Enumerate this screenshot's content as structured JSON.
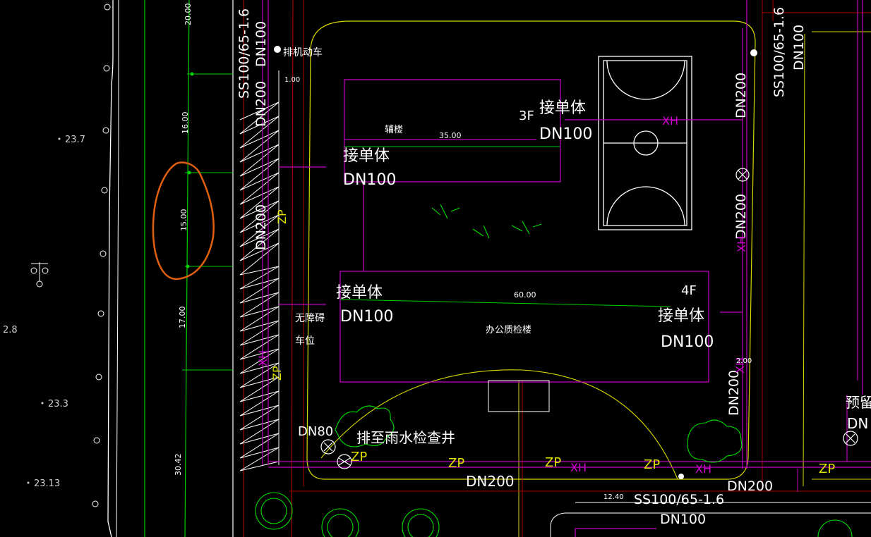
{
  "colors": {
    "background": "#000000",
    "green_line": "#00d000",
    "magenta_line": "#c000c0",
    "yellow_line": "#d8d800",
    "red_line": "#b00000",
    "white": "#ffffff",
    "annotation_orange": "#e06010"
  },
  "labels": {
    "top_left_pipe": "SS100/65-1.6",
    "top_left_dn100": "DN100",
    "top_left_dn200": "DN200",
    "top_right_pipe": "SS100/65-1.6",
    "top_right_dn200": "DN200",
    "top_right_dn100": "DN100",
    "exhaust_car": "排机动车",
    "val_100_a": "1.00",
    "val_100_b": "1.00",
    "aux_building": "辅楼",
    "aux_dim": "35.00",
    "office_building": "办公质检楼",
    "office_dim": "60.00",
    "floor_3f": "3F",
    "floor_4f": "4F",
    "single_connect": "接单体",
    "dn100": "DN100",
    "dn200": "DN200",
    "xh": "XH",
    "zp": "ZP",
    "accessible_parking_1": "无障碍",
    "accessible_parking_2": "车位",
    "dn80": "DN80",
    "to_rain_well": "排至雨水检查井",
    "bottom_pipe": "SS100/65-1.6",
    "bottom_dn100": "DN100",
    "bottom_val": "12.40",
    "reserve": "预留",
    "right_dn": "DN",
    "right_val": "2.00",
    "road_dim_top": "20.00",
    "road_dim_16": "16.00",
    "road_dim_15": "15.00",
    "road_dim_17": "17.00",
    "road_dim_3042": "30.42",
    "elev_237": "23.7",
    "elev_28": "2.8",
    "elev_233": "23.3",
    "elev_2313": "23.13",
    "dn200_left_vert": "DN200",
    "zp_left": "ZP",
    "xh_left": "XH",
    "dn200_right_vert": "DN200",
    "dn200_right_vert2": "DN200",
    "dn200_bottom_right": "DN200",
    "xh_right_vert": "XH"
  }
}
